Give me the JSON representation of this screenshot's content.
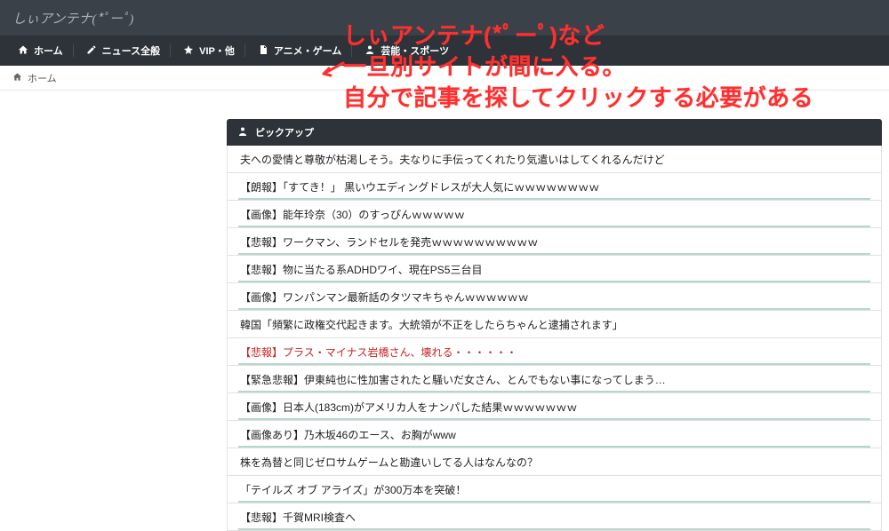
{
  "top": {
    "brand": "しぃアンテナ(*ﾟーﾟ)"
  },
  "nav": {
    "items": [
      {
        "icon": "home",
        "label": "ホーム"
      },
      {
        "icon": "pencil",
        "label": "ニュース全般"
      },
      {
        "icon": "star",
        "label": "VIP・他"
      },
      {
        "icon": "doc",
        "label": "アニメ・ゲーム"
      },
      {
        "icon": "person",
        "label": "芸能・スポーツ"
      }
    ]
  },
  "breadcrumb": {
    "home_label": "ホーム"
  },
  "column": {
    "pickup_label": "ピックアップ",
    "items": [
      {
        "text": "夫への愛情と尊敬が枯渇しそう。夫なりに手伝ってくれたり気遣いはしてくれるんだけど",
        "underline": false
      },
      {
        "text": "【朗報】「すてき！」 黒いウエディングドレスが大人気にｗｗｗｗｗｗｗｗ",
        "underline": true
      },
      {
        "text": "【画像】能年玲奈（30）のすっぴんｗｗｗｗｗ",
        "underline": true
      },
      {
        "text": "【悲報】ワークマン、ランドセルを発売ｗｗｗｗｗｗｗｗｗｗ",
        "underline": true
      },
      {
        "text": "【悲報】物に当たる系ADHDワイ、現在PS5三台目",
        "underline": true
      },
      {
        "text": "【画像】ワンパンマン最新話のタツマキちゃんｗｗｗｗｗｗ",
        "underline": true
      },
      {
        "text": "韓国「頻繁に政権交代起きます。大統領が不正をしたらちゃんと逮捕されます」",
        "underline": false
      },
      {
        "text": "【悲報】プラス・マイナス岩橋さん、壊れる・・・・・・",
        "underline": true,
        "red": true
      },
      {
        "text": "【緊急悲報】伊東純也に性加害されたと騒いだ女さん、とんでもない事になってしまう…",
        "underline": true
      },
      {
        "text": "【画像】日本人(183cm)がアメリカ人をナンパした結果ｗｗｗｗｗｗｗ",
        "underline": true
      },
      {
        "text": "【画像あり】乃木坂46のエース、お胸がwww",
        "underline": true
      },
      {
        "text": "株を為替と同じゼロサムゲームと勘違いしてる人はなんなの？",
        "underline": false
      },
      {
        "text": "「テイルズ オブ アライズ」が300万本を突破！",
        "underline": true
      },
      {
        "text": "【悲報】千賀MRI検査へ",
        "underline": true
      }
    ]
  },
  "overlay": {
    "line1": "しぃアンテナ(*ﾟーﾟ)など",
    "line2": "一旦別サイトが間に入る。",
    "line3": "自分で記事を探してクリックする必要がある"
  }
}
